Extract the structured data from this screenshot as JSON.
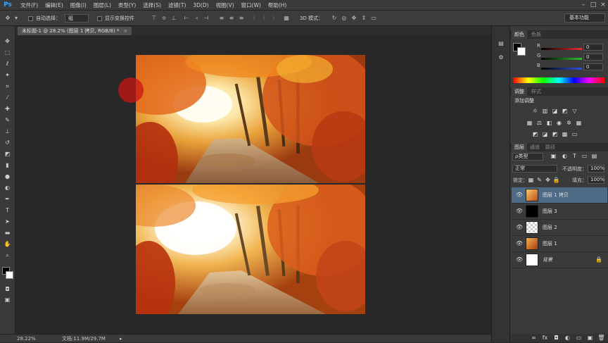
{
  "app": {
    "logo": "Ps"
  },
  "menu": [
    "文件(F)",
    "编辑(E)",
    "图像(I)",
    "图层(L)",
    "类型(Y)",
    "选择(S)",
    "滤镜(T)",
    "3D(D)",
    "视图(V)",
    "窗口(W)",
    "帮助(H)"
  ],
  "options": {
    "auto_select_label": "自动选择：",
    "auto_select_value": "组",
    "show_transform_label": "显示变换控件",
    "mode_3d_label": "3D 模式：",
    "workspace": "基本功能"
  },
  "document": {
    "tab_title": "未标题-1 @ 28.2% (图层 1 拷贝, RGB/8) *",
    "close": "×"
  },
  "status": {
    "zoom": "28.22%",
    "doc_size": "文档:11.9M/29.7M",
    "arrow": "▸"
  },
  "color_panel": {
    "tabs": [
      "颜色",
      "色板"
    ],
    "channels": [
      {
        "label": "R",
        "value": "0",
        "color": "#e23030"
      },
      {
        "label": "G",
        "value": "0",
        "color": "#30c030"
      },
      {
        "label": "B",
        "value": "0",
        "color": "#3050e0"
      }
    ]
  },
  "adjust_panel": {
    "tabs": [
      "调整",
      "样式"
    ],
    "title": "添加调整"
  },
  "layers_panel": {
    "tabs": [
      "图层",
      "通道",
      "路径"
    ],
    "filter": "ρ类型",
    "blend_mode": "正常",
    "opacity_label": "不透明度：",
    "opacity_value": "100%",
    "lock_label": "锁定：",
    "fill_label": "填充：",
    "fill_value": "100%",
    "layers": [
      {
        "name": "图层 1 拷贝",
        "selected": true,
        "locked": false
      },
      {
        "name": "图层 3",
        "selected": false,
        "locked": false
      },
      {
        "name": "图层 2",
        "selected": false,
        "locked": false
      },
      {
        "name": "图层 1",
        "selected": false,
        "locked": false
      },
      {
        "name": "背景",
        "selected": false,
        "locked": true
      }
    ],
    "footer_icons": [
      "link-icon",
      "fx-icon",
      "mask-icon",
      "adjustment-icon",
      "group-icon",
      "new-layer-icon",
      "trash-icon"
    ]
  },
  "colors": {
    "accent_selected": "#4f6a85",
    "foreground": "#000000",
    "background": "#ffffff"
  }
}
